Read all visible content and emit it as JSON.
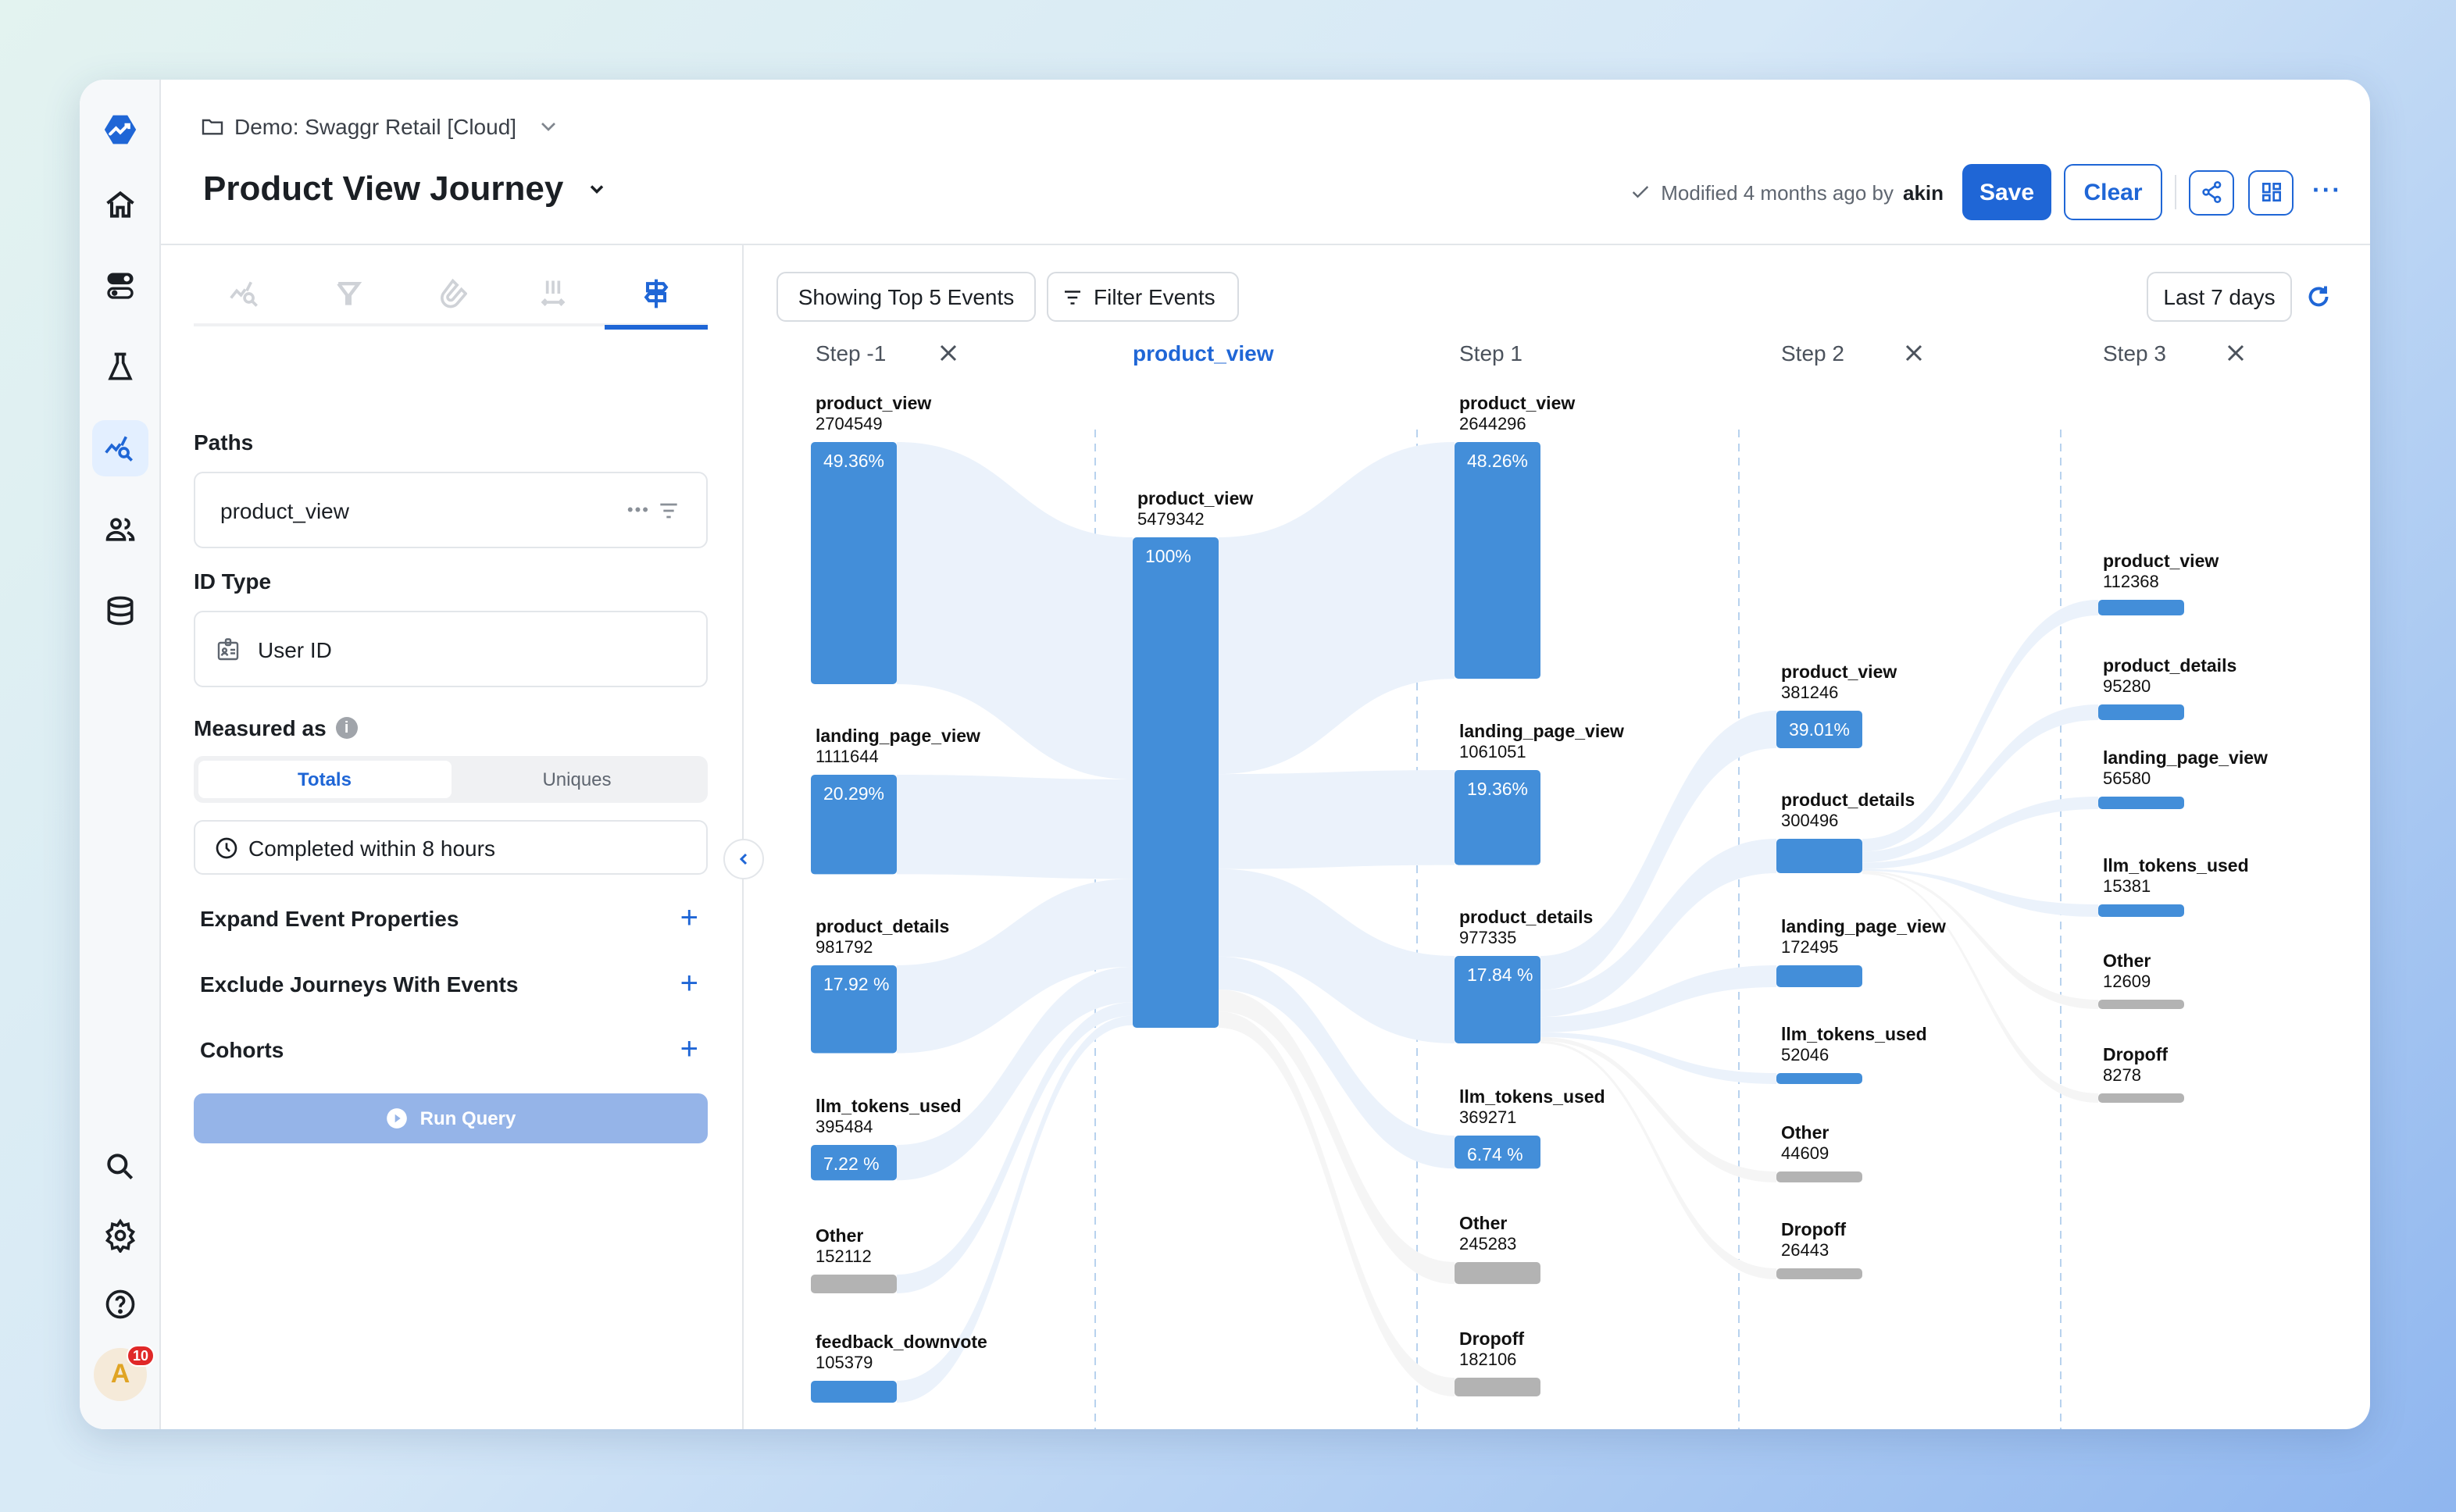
{
  "header": {
    "breadcrumb": "Demo: Swaggr Retail [Cloud]",
    "title": "Product View Journey",
    "modified_prefix": "Modified 4 months ago by",
    "modified_user": "akin",
    "save_label": "Save",
    "clear_label": "Clear",
    "more_label": "···"
  },
  "rail": {
    "items": [
      "logo-icon",
      "home-icon",
      "toggle-icon",
      "flask-icon",
      "analytics-search-icon",
      "users-icon",
      "database-icon"
    ],
    "bottom": [
      "search-icon",
      "gear-icon",
      "help-icon"
    ],
    "avatar_initial": "A",
    "notification_count": "10"
  },
  "panel": {
    "tabs": [
      "insights-tab",
      "funnel-tab",
      "retention-tab",
      "distribution-tab",
      "paths-tab"
    ],
    "active_tab": 4,
    "paths_label": "Paths",
    "paths_value": "product_view",
    "id_type_label": "ID Type",
    "id_type_value": "User ID",
    "measured_as_label": "Measured as",
    "measured_options": [
      "Totals",
      "Uniques"
    ],
    "measured_selected": "Totals",
    "completed_within": "Completed within 8 hours",
    "sections": [
      "Expand Event Properties",
      "Exclude Journeys With Events",
      "Cohorts"
    ],
    "run_label": "Run Query"
  },
  "toolbar": {
    "top_events_label": "Showing Top 5 Events",
    "filter_label": "Filter Events",
    "date_range": "Last 7 days"
  },
  "colors": {
    "accent": "#1f66d6",
    "node_blue": "#438ed9",
    "node_gray": "#b3b3b3",
    "link_blue": "#ebf2fb",
    "link_gray": "#f5f5f5",
    "divider": "#b8d2ee"
  },
  "chart_data": {
    "type": "sankey",
    "title": "Product View Journey",
    "columns": [
      {
        "header": "Step -1",
        "closable": true,
        "highlight": false,
        "nodes": [
          {
            "name": "product_view",
            "value": 2704549,
            "pct": "49.36%",
            "kind": "event"
          },
          {
            "name": "landing_page_view",
            "value": 1111644,
            "pct": "20.29%",
            "kind": "event"
          },
          {
            "name": "product_details",
            "value": 981792,
            "pct": "17.92 %",
            "kind": "event"
          },
          {
            "name": "llm_tokens_used",
            "value": 395484,
            "pct": "7.22 %",
            "kind": "event"
          },
          {
            "name": "Other",
            "value": 152112,
            "pct": "",
            "kind": "other"
          },
          {
            "name": "feedback_downvote",
            "value": 105379,
            "pct": "",
            "kind": "event"
          }
        ]
      },
      {
        "header": "product_view",
        "closable": false,
        "highlight": true,
        "nodes": [
          {
            "name": "product_view",
            "value": 5479342,
            "pct": "100%",
            "kind": "event"
          }
        ]
      },
      {
        "header": "Step 1",
        "closable": false,
        "highlight": false,
        "nodes": [
          {
            "name": "product_view",
            "value": 2644296,
            "pct": "48.26%",
            "kind": "event"
          },
          {
            "name": "landing_page_view",
            "value": 1061051,
            "pct": "19.36%",
            "kind": "event"
          },
          {
            "name": "product_details",
            "value": 977335,
            "pct": "17.84 %",
            "kind": "event"
          },
          {
            "name": "llm_tokens_used",
            "value": 369271,
            "pct": "6.74 %",
            "kind": "event"
          },
          {
            "name": "Other",
            "value": 245283,
            "pct": "",
            "kind": "other"
          },
          {
            "name": "Dropoff",
            "value": 182106,
            "pct": "",
            "kind": "other"
          }
        ]
      },
      {
        "header": "Step 2",
        "closable": true,
        "highlight": false,
        "nodes": [
          {
            "name": "product_view",
            "value": 381246,
            "pct": "39.01%",
            "kind": "event"
          },
          {
            "name": "product_details",
            "value": 300496,
            "pct": "",
            "kind": "event"
          },
          {
            "name": "landing_page_view",
            "value": 172495,
            "pct": "",
            "kind": "event"
          },
          {
            "name": "llm_tokens_used",
            "value": 52046,
            "pct": "",
            "kind": "event"
          },
          {
            "name": "Other",
            "value": 44609,
            "pct": "",
            "kind": "other"
          },
          {
            "name": "Dropoff",
            "value": 26443,
            "pct": "",
            "kind": "other"
          }
        ]
      },
      {
        "header": "Step 3",
        "closable": true,
        "highlight": false,
        "nodes": [
          {
            "name": "product_view",
            "value": 112368,
            "pct": "",
            "kind": "event"
          },
          {
            "name": "product_details",
            "value": 95280,
            "pct": "",
            "kind": "event"
          },
          {
            "name": "landing_page_view",
            "value": 56580,
            "pct": "",
            "kind": "event"
          },
          {
            "name": "llm_tokens_used",
            "value": 15381,
            "pct": "",
            "kind": "event"
          },
          {
            "name": "Other",
            "value": 12609,
            "pct": "",
            "kind": "other"
          },
          {
            "name": "Dropoff",
            "value": 8278,
            "pct": "",
            "kind": "other"
          }
        ]
      }
    ],
    "links": [
      {
        "from": [
          0,
          0
        ],
        "to": [
          1,
          0
        ]
      },
      {
        "from": [
          0,
          1
        ],
        "to": [
          1,
          0
        ]
      },
      {
        "from": [
          0,
          2
        ],
        "to": [
          1,
          0
        ]
      },
      {
        "from": [
          0,
          3
        ],
        "to": [
          1,
          0
        ]
      },
      {
        "from": [
          0,
          4
        ],
        "to": [
          1,
          0
        ]
      },
      {
        "from": [
          0,
          5
        ],
        "to": [
          1,
          0
        ]
      },
      {
        "from": [
          1,
          0
        ],
        "to": [
          2,
          0
        ]
      },
      {
        "from": [
          1,
          0
        ],
        "to": [
          2,
          1
        ]
      },
      {
        "from": [
          1,
          0
        ],
        "to": [
          2,
          2
        ]
      },
      {
        "from": [
          1,
          0
        ],
        "to": [
          2,
          3
        ]
      },
      {
        "from": [
          1,
          0
        ],
        "to": [
          2,
          4
        ]
      },
      {
        "from": [
          1,
          0
        ],
        "to": [
          2,
          5
        ]
      },
      {
        "from": [
          2,
          2
        ],
        "to": [
          3,
          0
        ]
      },
      {
        "from": [
          2,
          2
        ],
        "to": [
          3,
          1
        ]
      },
      {
        "from": [
          2,
          2
        ],
        "to": [
          3,
          2
        ]
      },
      {
        "from": [
          2,
          2
        ],
        "to": [
          3,
          3
        ]
      },
      {
        "from": [
          2,
          2
        ],
        "to": [
          3,
          4
        ]
      },
      {
        "from": [
          2,
          2
        ],
        "to": [
          3,
          5
        ]
      },
      {
        "from": [
          3,
          1
        ],
        "to": [
          4,
          0
        ]
      },
      {
        "from": [
          3,
          1
        ],
        "to": [
          4,
          1
        ]
      },
      {
        "from": [
          3,
          1
        ],
        "to": [
          4,
          2
        ]
      },
      {
        "from": [
          3,
          1
        ],
        "to": [
          4,
          3
        ]
      },
      {
        "from": [
          3,
          1
        ],
        "to": [
          4,
          4
        ]
      },
      {
        "from": [
          3,
          1
        ],
        "to": [
          4,
          5
        ]
      }
    ]
  }
}
